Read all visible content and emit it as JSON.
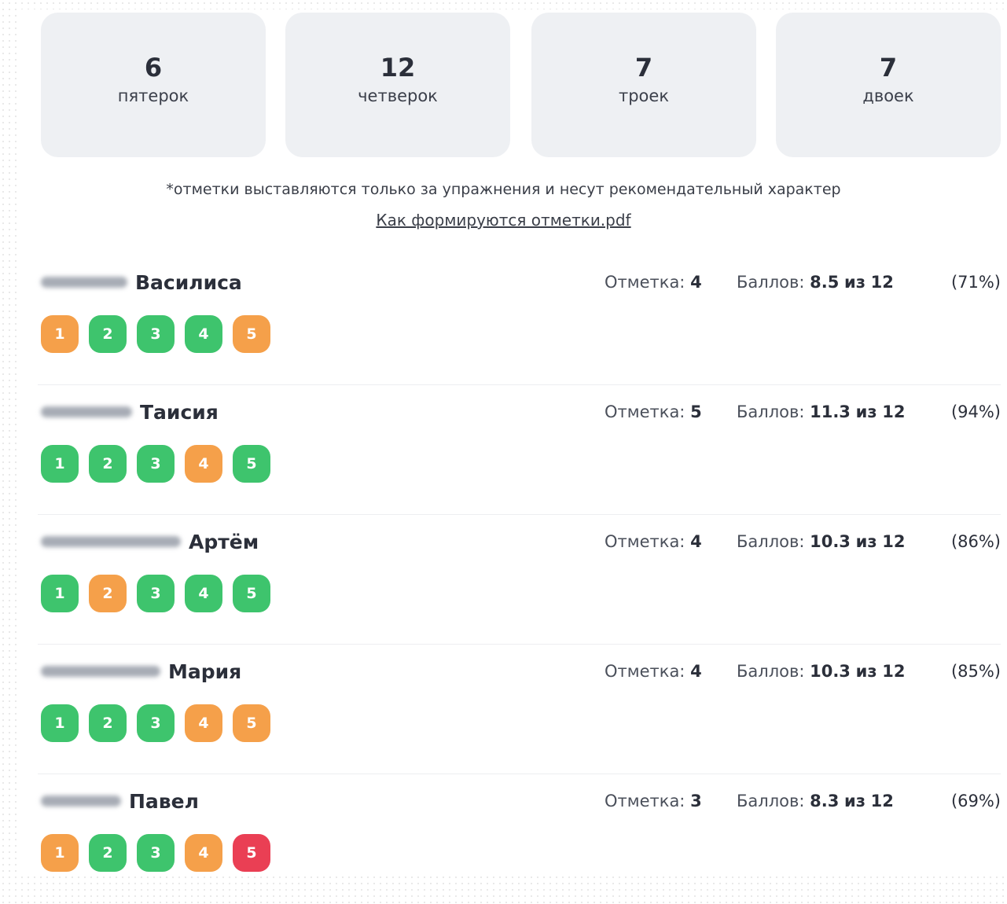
{
  "stats": [
    {
      "count": "6",
      "label": "пятерок"
    },
    {
      "count": "12",
      "label": "четверок"
    },
    {
      "count": "7",
      "label": "троек"
    },
    {
      "count": "7",
      "label": "двоек"
    }
  ],
  "note": "*отметки выставляются только за упражнения и несут рекомендательный характер",
  "pdf_link": "Как формируются отметки.pdf",
  "labels": {
    "grade": "Отметка:",
    "score": "Баллов:",
    "of": "из"
  },
  "colors": {
    "green": "#3ec46d",
    "orange": "#f5a04a",
    "red": "#ea3f54"
  },
  "students": [
    {
      "first_name": "Василиса",
      "grade": "4",
      "points": "8.5",
      "max": "12",
      "percent": "(71%)",
      "tasks": [
        {
          "n": "1",
          "status": "orange"
        },
        {
          "n": "2",
          "status": "green"
        },
        {
          "n": "3",
          "status": "green"
        },
        {
          "n": "4",
          "status": "green"
        },
        {
          "n": "5",
          "status": "orange"
        }
      ]
    },
    {
      "first_name": "Таисия",
      "grade": "5",
      "points": "11.3",
      "max": "12",
      "percent": "(94%)",
      "tasks": [
        {
          "n": "1",
          "status": "green"
        },
        {
          "n": "2",
          "status": "green"
        },
        {
          "n": "3",
          "status": "green"
        },
        {
          "n": "4",
          "status": "orange"
        },
        {
          "n": "5",
          "status": "green"
        }
      ]
    },
    {
      "first_name": "Артём",
      "grade": "4",
      "points": "10.3",
      "max": "12",
      "percent": "(86%)",
      "tasks": [
        {
          "n": "1",
          "status": "green"
        },
        {
          "n": "2",
          "status": "orange"
        },
        {
          "n": "3",
          "status": "green"
        },
        {
          "n": "4",
          "status": "green"
        },
        {
          "n": "5",
          "status": "green"
        }
      ]
    },
    {
      "first_name": "Мария",
      "grade": "4",
      "points": "10.3",
      "max": "12",
      "percent": "(85%)",
      "tasks": [
        {
          "n": "1",
          "status": "green"
        },
        {
          "n": "2",
          "status": "green"
        },
        {
          "n": "3",
          "status": "green"
        },
        {
          "n": "4",
          "status": "orange"
        },
        {
          "n": "5",
          "status": "orange"
        }
      ]
    },
    {
      "first_name": "Павел",
      "grade": "3",
      "points": "8.3",
      "max": "12",
      "percent": "(69%)",
      "tasks": [
        {
          "n": "1",
          "status": "orange"
        },
        {
          "n": "2",
          "status": "green"
        },
        {
          "n": "3",
          "status": "green"
        },
        {
          "n": "4",
          "status": "orange"
        },
        {
          "n": "5",
          "status": "red"
        }
      ]
    }
  ]
}
